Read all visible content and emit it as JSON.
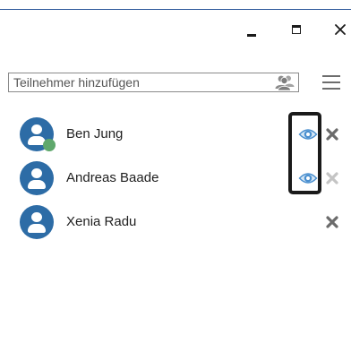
{
  "window_controls": {
    "minimize": "minimize-icon",
    "maximize": "maximize-icon",
    "close": "close-icon"
  },
  "search": {
    "placeholder": "Teilnehmer hinzufügen",
    "value": "",
    "icon": "people-icon"
  },
  "menu": {
    "icon": "hamburger-menu-icon"
  },
  "participants": [
    {
      "name": "Ben Jung",
      "online": true,
      "view_icon": true,
      "remove_enabled": true
    },
    {
      "name": "Andreas Baade",
      "online": false,
      "view_icon": true,
      "remove_enabled": false
    },
    {
      "name": "Xenia Radu",
      "online": false,
      "view_icon": false,
      "remove_enabled": true
    }
  ],
  "colors": {
    "accent": "#2b579a",
    "avatar": "#2d6ca6",
    "online_status": "#5fa86c",
    "eye_icon": "#4a8fcf",
    "remove_active": "#6b6b6b",
    "remove_disabled": "#c4c4c4",
    "highlight_frame": "#1a1a1a"
  }
}
